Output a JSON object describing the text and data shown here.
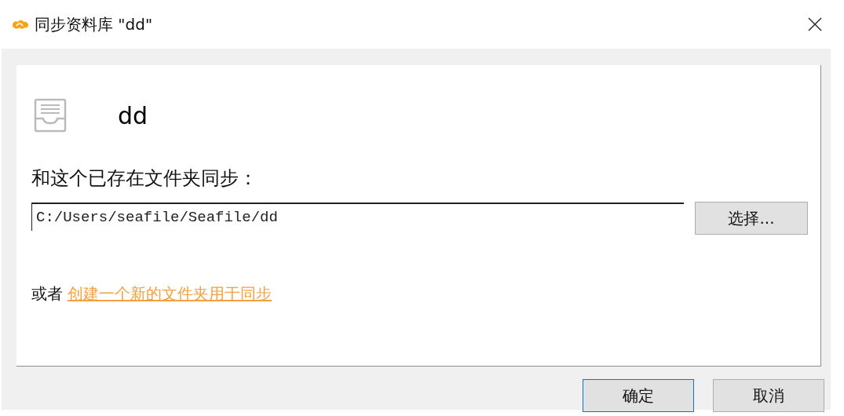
{
  "window": {
    "title": "同步资料库 \"dd\""
  },
  "library": {
    "name": "dd"
  },
  "prompt": "和这个已存在文件夹同步：",
  "folder_field": {
    "value": "C:/Users/seafile/Seafile/dd"
  },
  "choose_button": "选择...",
  "alternative": {
    "prefix": "或者",
    "link": "创建一个新的文件夹用于同步"
  },
  "buttons": [
    {
      "label": "确定",
      "default": true
    },
    {
      "label": "取消",
      "default": false
    }
  ]
}
